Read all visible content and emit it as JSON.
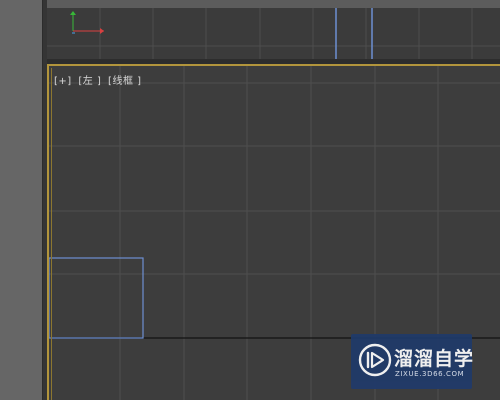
{
  "viewport_left": {
    "label_plus": "[+]",
    "label_view": "[左 ]",
    "label_mode": "[线框 ]"
  },
  "colors": {
    "active_border": "#b2953c",
    "grid": "#4e4e4e",
    "selection_outline": "#6d8fd3",
    "axis_x": "#d84040",
    "axis_y": "#38b838"
  },
  "watermark": {
    "title": "溜溜自学",
    "subtitle": "ZIXUE.3D66.COM",
    "icon": "play-logo-icon"
  }
}
